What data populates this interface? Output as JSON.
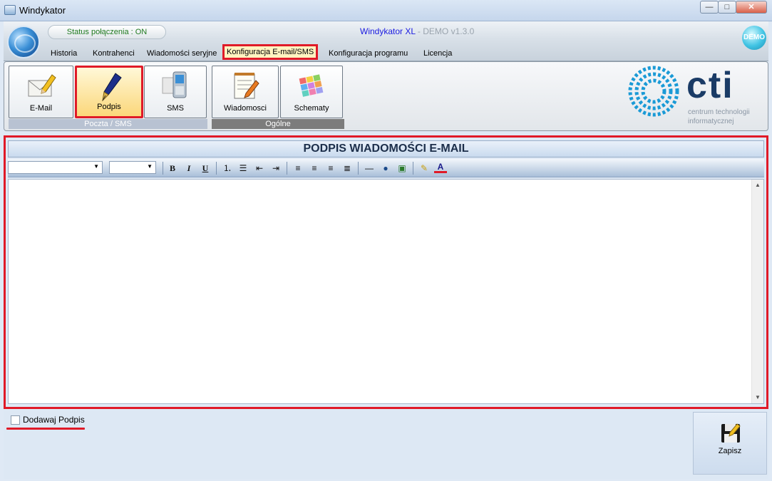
{
  "window": {
    "title": "Windykator",
    "min": "—",
    "max": "□",
    "close": "✕"
  },
  "header": {
    "status": "Status połączenia : ON",
    "app_name": "Windykator XL",
    "app_version": " - DEMO v1.3.0",
    "badge": "DEMO",
    "menu": [
      {
        "label": "Historia"
      },
      {
        "label": "Kontrahenci"
      },
      {
        "label": "Wiadomości seryjne"
      },
      {
        "label": "Konfiguracja E-mail/SMS",
        "active": true
      },
      {
        "label": "Konfiguracja programu"
      },
      {
        "label": "Licencja"
      }
    ]
  },
  "ribbon": {
    "buttons": [
      {
        "label": "E-Mail",
        "icon": "email-pencil-icon"
      },
      {
        "label": "Podpis",
        "icon": "fountain-pen-icon",
        "selected": true
      },
      {
        "label": "SMS",
        "icon": "phone-icon"
      },
      {
        "label": "Wiadomosci",
        "icon": "notepad-icon"
      },
      {
        "label": "Schematy",
        "icon": "color-palette-icon"
      }
    ],
    "groups": [
      {
        "label": "Poczta / SMS"
      },
      {
        "label": "Ogólne"
      }
    ]
  },
  "logo": {
    "text": "cti",
    "line1": "centrum technologii",
    "line2": "informatycznej"
  },
  "editor": {
    "title": "PODPIS WIADOMOŚCI E-MAIL",
    "font_value": "",
    "size_value": "",
    "toolbar": {
      "bold": "B",
      "italic": "I",
      "underline": "U",
      "icons": [
        "ordered-list-icon",
        "unordered-list-icon",
        "outdent-icon",
        "indent-icon",
        "align-left-icon",
        "align-center-icon",
        "align-right-icon",
        "justify-icon",
        "horizontal-rule-icon",
        "link-icon",
        "image-icon",
        "highlight-icon",
        "font-color-icon"
      ]
    },
    "content": ""
  },
  "bottom": {
    "checkbox_label": "Dodawaj Podpis",
    "checked": false,
    "save_label": "Zapisz"
  },
  "colors": {
    "highlight_red": "#e01a28",
    "brand_blue": "#1a9ad6",
    "title_blue": "#1a1ae0"
  }
}
